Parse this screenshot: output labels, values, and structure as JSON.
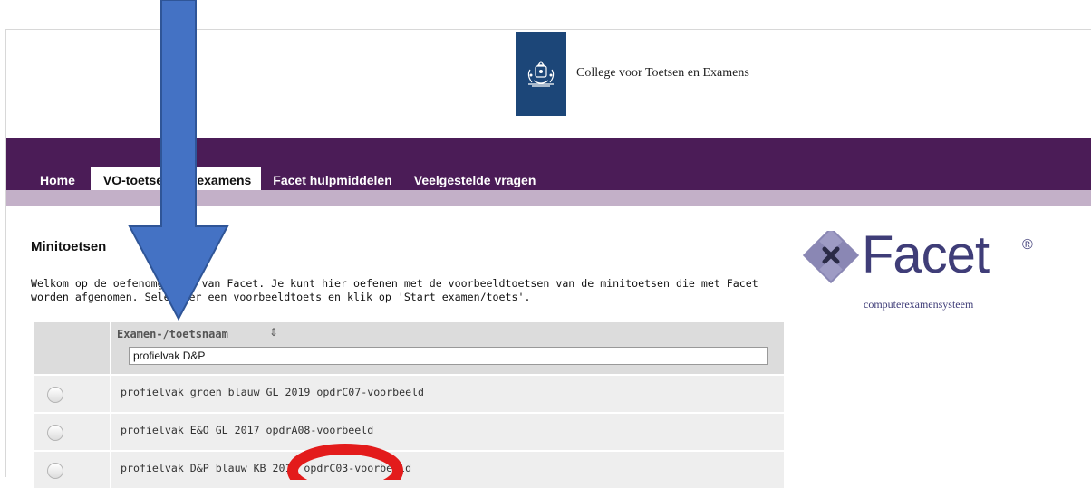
{
  "header": {
    "org_name": "College voor Toetsen en Examens",
    "brand_color": "#1c4678"
  },
  "nav": {
    "bar_color": "#4b1c57",
    "tabs": [
      {
        "label": "Home",
        "active": false
      },
      {
        "label": "VO-toetsen en -examens",
        "active": true
      },
      {
        "label": "Facet hulpmiddelen",
        "active": false
      },
      {
        "label": "Veelgestelde vragen",
        "active": false
      }
    ]
  },
  "main": {
    "title": "Minitoetsen",
    "intro": "Welkom op de oefenomgeving van Facet. Je kunt hier oefenen met de voorbeeldtoetsen van de minitoetsen die met Facet worden afgenomen. Selecteer een voorbeeldtoets en klik op 'Start examen/toets'."
  },
  "facet_logo": {
    "name": "Facet",
    "registered": "®",
    "tagline": "computerexamensysteem",
    "color": "#3f3d78"
  },
  "table": {
    "column_header": "Examen-/toetsnaam",
    "filter_value": "profielvak D&P",
    "rows": [
      {
        "name": "profielvak groen blauw GL 2019 opdrC07-voorbeeld"
      },
      {
        "name": "profielvak E&O GL 2017 opdrA08-voorbeeld"
      },
      {
        "name": "profielvak D&P blauw KB 2018 opdrC03-voorbeeld"
      }
    ]
  },
  "annotations": {
    "arrow_color": "#4472c4",
    "circle_color": "#e31b1b"
  }
}
